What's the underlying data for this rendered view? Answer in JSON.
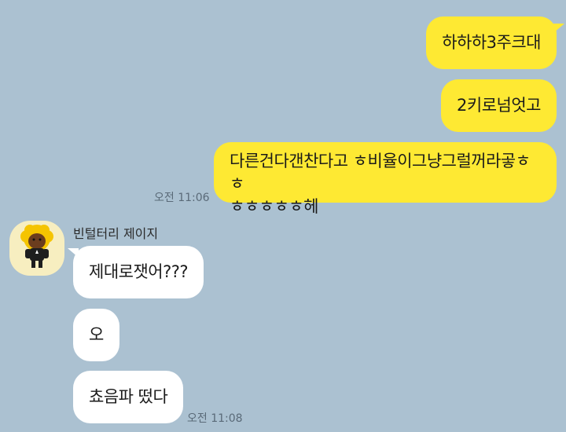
{
  "chat": {
    "sent_messages": [
      {
        "text": "하하하3주크대"
      },
      {
        "text": "2키로넘엇고"
      },
      {
        "line1": "다른건다갠찬다고 ㅎ비율이그냥그럴꺼라곻ㅎㅎ",
        "line2": "ㅎㅎㅎㅎㅎ헤"
      }
    ],
    "sent_time": "오전 11:06",
    "sender_name": "빈털터리 제이지",
    "received_messages": [
      {
        "text": "제대로잿어???"
      },
      {
        "text": "오"
      },
      {
        "text": "쵸음파 떴다"
      }
    ],
    "received_time": "오전 11:08"
  },
  "colors": {
    "background": "#abc1d1",
    "my_bubble": "#fee933",
    "their_bubble": "#ffffff"
  },
  "icons": {
    "avatar": "character-avatar-icon"
  }
}
